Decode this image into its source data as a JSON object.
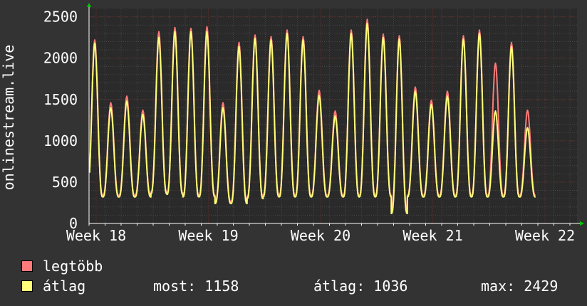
{
  "colors": {
    "background": "#333333",
    "plot_bg": "#2a2a2a",
    "grid_major": "#5a2a2a",
    "grid_minor": "#474747",
    "axis": "#ffffff",
    "max_line": "#ff7a7a",
    "avg_line": "#ffff7a"
  },
  "legend": {
    "max_label": "legtöbb",
    "avg_label": "átlag",
    "now": "most: 1158",
    "avg": "átlag: 1036",
    "max": "max: 2429"
  },
  "chart_data": {
    "type": "line",
    "ylabel": "onlinestream.live",
    "ylim": [
      0,
      2600
    ],
    "yticks": [
      0,
      500,
      1000,
      1500,
      2000,
      2500
    ],
    "xticks": [
      "Week 18",
      "Week 19",
      "Week 20",
      "Week 21",
      "Week 22"
    ],
    "days_per_week": 7,
    "start_offset_days": 0,
    "series": [
      {
        "name": "legtöbb",
        "color": "#ff7a7a",
        "peaks": [
          2220,
          1460,
          1540,
          1370,
          2320,
          2370,
          2360,
          2380,
          1460,
          2190,
          2280,
          2260,
          2340,
          2260,
          1610,
          1360,
          2340,
          2470,
          2290,
          2270,
          1650,
          1490,
          1600,
          2270,
          2340,
          1940,
          2190,
          1370
        ],
        "troughs": [
          340,
          340,
          340,
          340,
          380,
          370,
          340,
          340,
          260,
          270,
          320,
          350,
          340,
          340,
          340,
          340,
          340,
          340,
          340,
          180,
          340,
          340,
          340,
          340,
          340,
          340,
          340,
          340
        ]
      },
      {
        "name": "átlag",
        "color": "#ffff7a",
        "peaks": [
          2180,
          1400,
          1480,
          1320,
          2250,
          2320,
          2320,
          2320,
          1400,
          2140,
          2240,
          2220,
          2300,
          2220,
          1550,
          1300,
          2300,
          2420,
          2250,
          2230,
          1600,
          1440,
          1540,
          2230,
          2300,
          1360,
          2140,
          1158
        ],
        "troughs": [
          320,
          320,
          320,
          320,
          360,
          350,
          320,
          320,
          240,
          240,
          300,
          320,
          320,
          320,
          320,
          320,
          320,
          320,
          320,
          120,
          320,
          320,
          320,
          320,
          320,
          320,
          320,
          320
        ]
      }
    ]
  }
}
